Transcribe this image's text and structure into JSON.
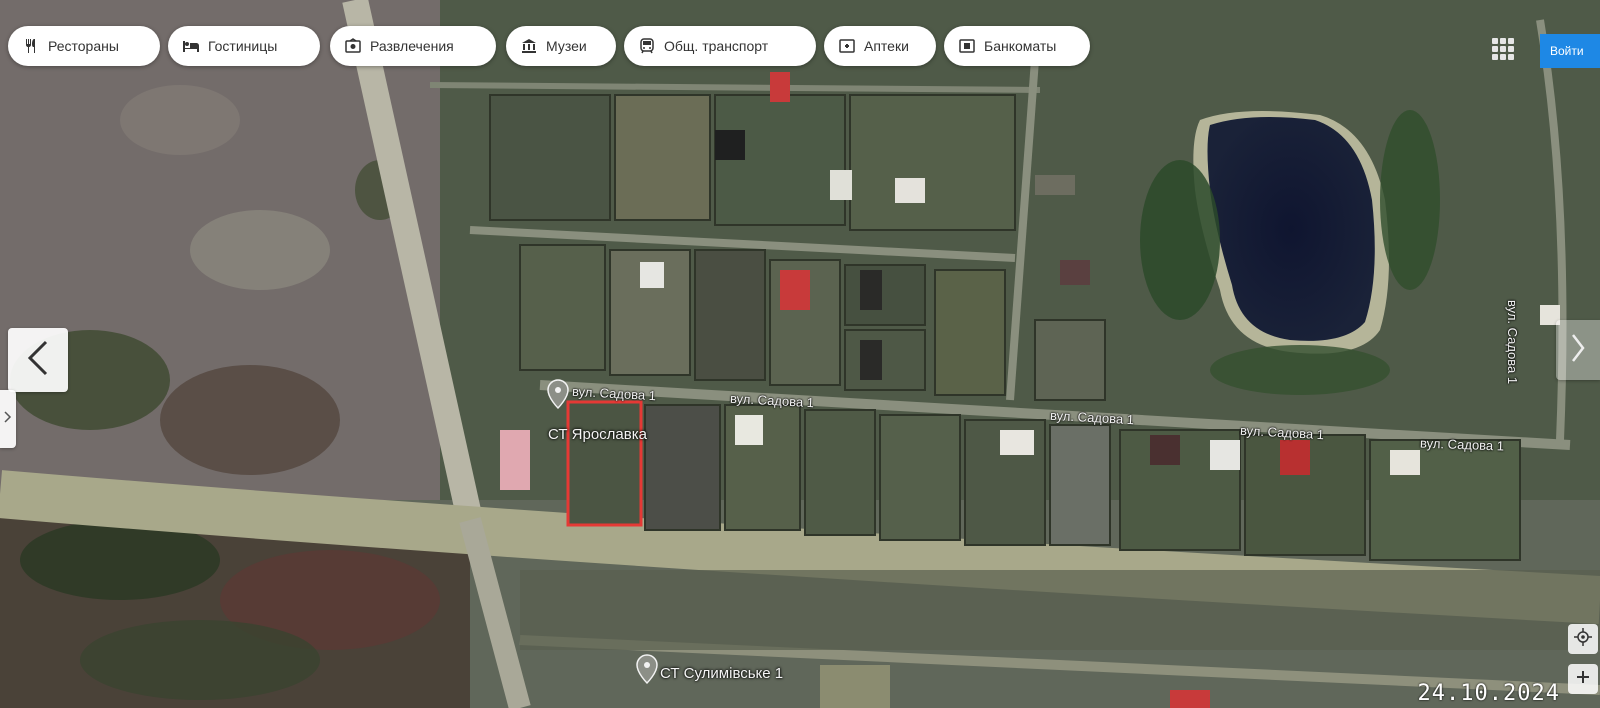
{
  "toolbar": {
    "chips": [
      {
        "label": "Рестораны",
        "icon": "restaurant-icon"
      },
      {
        "label": "Гостиницы",
        "icon": "hotel-icon"
      },
      {
        "label": "Развлечения",
        "icon": "entertainment-icon"
      },
      {
        "label": "Музеи",
        "icon": "museum-icon"
      },
      {
        "label": "Общ. транспорт",
        "icon": "transit-icon"
      },
      {
        "label": "Аптеки",
        "icon": "pharmacy-icon"
      },
      {
        "label": "Банкоматы",
        "icon": "atm-icon"
      }
    ],
    "right_button_label": "Войти"
  },
  "map": {
    "streets": [
      {
        "label": "вул. Садова 1"
      },
      {
        "label": "вул. Садова 1"
      },
      {
        "label": "вул. Садова 1"
      },
      {
        "label": "вул. Садова 1"
      },
      {
        "label": "вул. Садова 1"
      },
      {
        "label": "вул. Садова 1"
      }
    ],
    "pois": [
      {
        "label": "СТ Ярославка"
      },
      {
        "label": "СТ Сулимівське 1"
      }
    ],
    "highlight_color": "#e53935"
  },
  "photo": {
    "date": "24.10.2024"
  }
}
